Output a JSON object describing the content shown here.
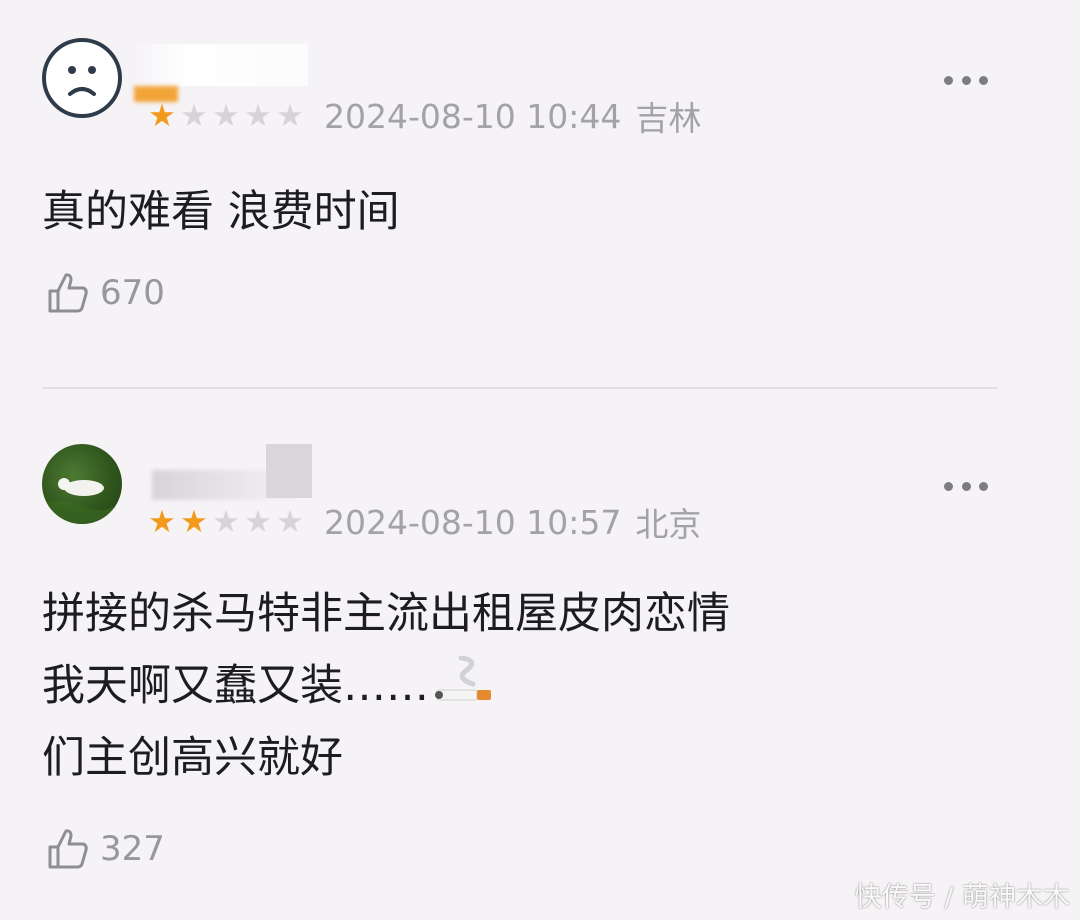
{
  "comments": [
    {
      "rating": 1,
      "rating_max": 5,
      "datetime": "2024-08-10 10:44",
      "location": "吉林",
      "lines": [
        "真的难看 浪费时间"
      ],
      "likes": "670",
      "avatar_icon": "sad-face-icon"
    },
    {
      "rating": 2,
      "rating_max": 5,
      "datetime": "2024-08-10 10:57",
      "location": "北京",
      "lines": [
        "拼接的杀马特非主流出租屋皮肉恋情",
        "我天啊又蠢又装……",
        "们主创高兴就好"
      ],
      "likes": "327",
      "avatar_icon": "white-cat-on-grass-photo"
    }
  ],
  "icons": {
    "like": "thumbs-up-outline-icon",
    "more": "more-dots-icon",
    "emoji": "cigarette-emoji"
  },
  "colors": {
    "background": "#f6f3f7",
    "star_on": "#f39a1d",
    "star_off": "#d6d4d8",
    "meta_text": "#a3a2a7"
  },
  "watermark": "快传号 / 萌神木木"
}
